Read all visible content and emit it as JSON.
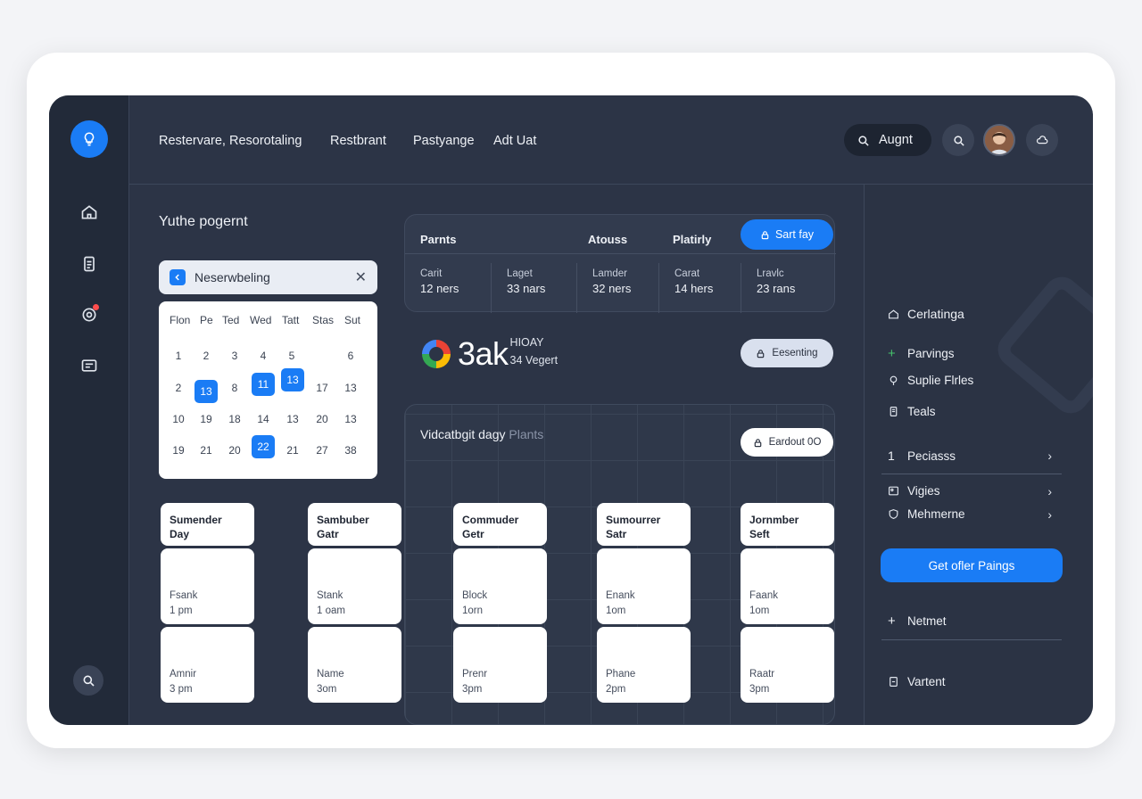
{
  "header": {
    "nav": [
      "Restervare, Resorotaling",
      "Restbrant",
      "Pastyange",
      "Adt Uat"
    ],
    "search_label": "Augnt"
  },
  "sidebar": {
    "icons": [
      "lightbulb-icon",
      "home-icon",
      "document-icon",
      "target-icon",
      "card-icon",
      "search-icon"
    ],
    "accent": "#1a7cf5"
  },
  "left": {
    "title": "Yuthe pogernt",
    "calendar_header": "Neserwbeling",
    "weekdays": [
      "Flon",
      "Pe",
      "Ted",
      "Wed",
      "Tatt",
      "Stas",
      "Sut"
    ],
    "weeks": [
      [
        "1",
        "2",
        "3",
        "4",
        "5",
        "6"
      ],
      [
        "2",
        "13",
        "8",
        "11",
        "13",
        "17",
        "13"
      ],
      [
        "10",
        "19",
        "18",
        "14",
        "13",
        "20",
        "13"
      ],
      [
        "19",
        "21",
        "20",
        "22",
        "21",
        "27",
        "38"
      ]
    ]
  },
  "stats": {
    "headers": [
      "Parnts",
      "Atouss",
      "Platirly"
    ],
    "button": "Sart fay",
    "items": [
      {
        "label": "Carit",
        "value": "12 ners"
      },
      {
        "label": "Laget",
        "value": "33 nars"
      },
      {
        "label": "Lamder",
        "value": "32 ners"
      },
      {
        "label": "Carat",
        "value": "14 hers"
      },
      {
        "label": "Lravlc",
        "value": "23 rans"
      }
    ]
  },
  "highlight": {
    "value": "3ak",
    "sup": "HIOAY",
    "sub": "34 Vegert",
    "button": "Eesenting"
  },
  "schedule": {
    "title": "Vidcatbgit dagy",
    "title_muted": "Plants",
    "button": "Eardout 0O",
    "columns": [
      {
        "head": [
          "Sumender",
          "Day"
        ],
        "slots": [
          [
            "Fsank",
            "1 pm"
          ],
          [
            "Amnir",
            "3 pm"
          ]
        ]
      },
      {
        "head": [
          "Sambuber",
          "Gatr"
        ],
        "slots": [
          [
            "Stank",
            "1 oam"
          ],
          [
            "Name",
            "3om"
          ]
        ]
      },
      {
        "head": [
          "Commuder",
          "Getr"
        ],
        "slots": [
          [
            "Block",
            "1orn"
          ],
          [
            "Prenr",
            "3pm"
          ]
        ]
      },
      {
        "head": [
          "Sumourrer",
          "Satr"
        ],
        "slots": [
          [
            "Enank",
            "1om"
          ],
          [
            "Phane",
            "2pm"
          ]
        ]
      },
      {
        "head": [
          "Jornmber",
          "Seft"
        ],
        "slots": [
          [
            "Faank",
            "1om"
          ],
          [
            "Raatr",
            "3pm"
          ]
        ]
      }
    ]
  },
  "right": {
    "items": [
      "Cerlatinga",
      "Parvings",
      "Suplie Flrles",
      "Teals"
    ],
    "pecs_index": "1",
    "pecs": "Peciasss",
    "vigies": "Vigies",
    "mehmerne": "Mehmerne",
    "cta": "Get ofler Paings",
    "netmet": "Netmet",
    "vartent": "Vartent"
  }
}
